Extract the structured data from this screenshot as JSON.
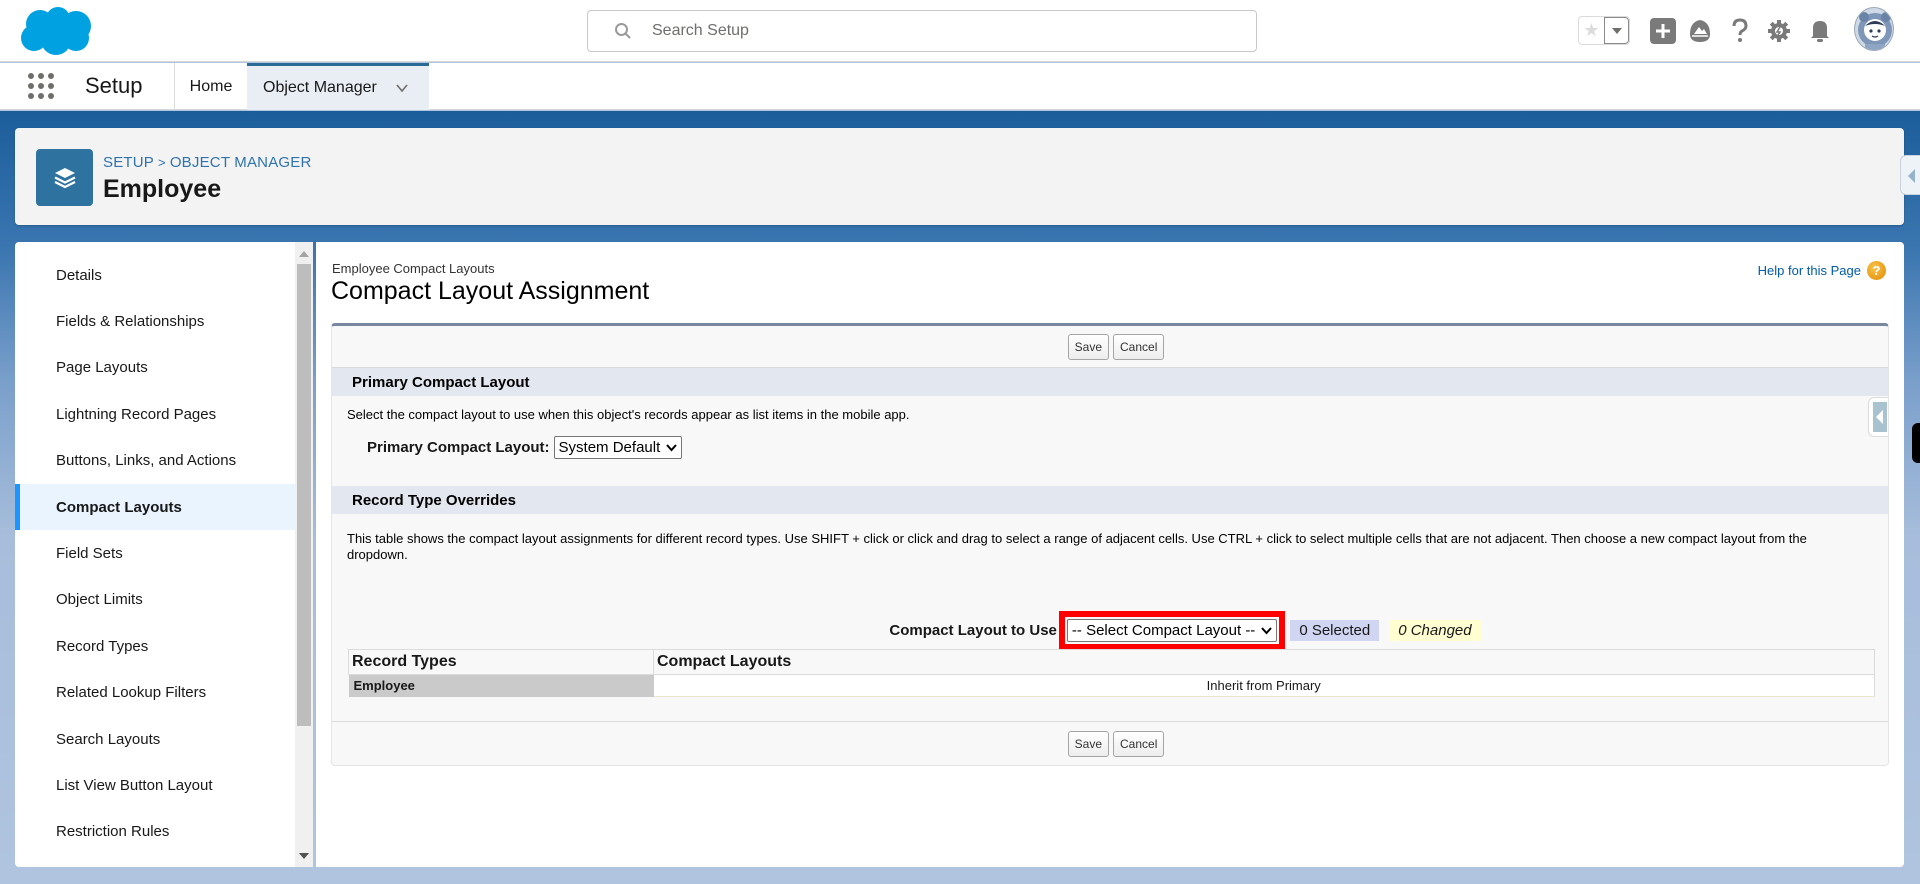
{
  "header": {
    "search_placeholder": "Search Setup",
    "icons": [
      "favorites-star-icon",
      "favorites-dropdown-icon",
      "global-actions-add-icon",
      "trailhead-icon",
      "help-icon",
      "setup-gear-icon",
      "notifications-bell-icon",
      "user-avatar"
    ]
  },
  "nav": {
    "app_name": "Setup",
    "tabs": [
      {
        "label": "Home"
      },
      {
        "label": "Object Manager",
        "active": true
      }
    ]
  },
  "object_header": {
    "breadcrumb": [
      "SETUP",
      "OBJECT MANAGER"
    ],
    "breadcrumb_separator": ">",
    "title": "Employee",
    "icon": "layers-icon"
  },
  "sidebar": {
    "items": [
      {
        "label": "Details"
      },
      {
        "label": "Fields & Relationships"
      },
      {
        "label": "Page Layouts"
      },
      {
        "label": "Lightning Record Pages"
      },
      {
        "label": "Buttons, Links, and Actions"
      },
      {
        "label": "Compact Layouts",
        "active": true
      },
      {
        "label": "Field Sets"
      },
      {
        "label": "Object Limits"
      },
      {
        "label": "Record Types"
      },
      {
        "label": "Related Lookup Filters"
      },
      {
        "label": "Search Layouts"
      },
      {
        "label": "List View Button Layout"
      },
      {
        "label": "Restriction Rules"
      }
    ]
  },
  "main": {
    "subtitle": "Employee Compact Layouts",
    "title": "Compact Layout Assignment",
    "help_link": "Help for this Page",
    "save_label": "Save",
    "cancel_label": "Cancel",
    "primary_section": {
      "heading": "Primary Compact Layout",
      "description": "Select the compact layout to use when this object's records appear as list items in the mobile app.",
      "field_label": "Primary Compact Layout:",
      "field_value": "System Default"
    },
    "overrides_section": {
      "heading": "Record Type Overrides",
      "description": "This table shows the compact layout assignments for different record types. Use SHIFT + click or click and drag to select a range of adjacent cells. Use CTRL + click to select multiple cells that are not adjacent. Then choose a new compact layout from the dropdown.",
      "field_label": "Compact Layout to Use",
      "field_value": "-- Select Compact Layout --",
      "selected_count": "0 Selected",
      "changed_count": "0 Changed",
      "table": {
        "headers": [
          "Record Types",
          "Compact Layouts"
        ],
        "rows": [
          {
            "record_type": "Employee",
            "compact_layout": "Inherit from Primary"
          }
        ]
      }
    }
  }
}
